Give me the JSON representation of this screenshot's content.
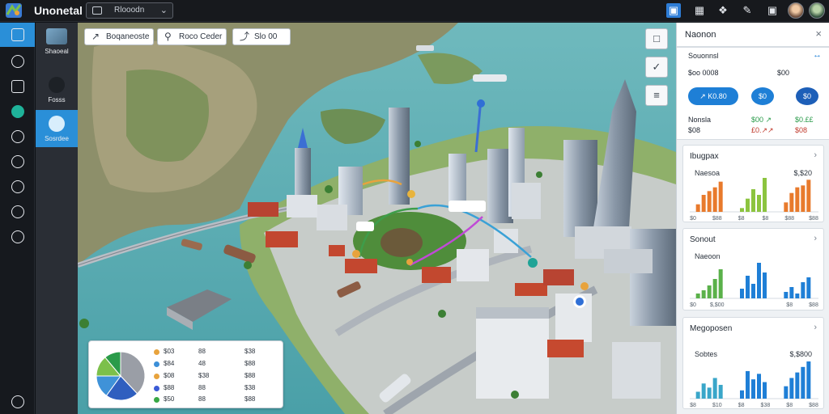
{
  "topbar": {
    "app_title": "Unonetal",
    "view_select": "Rlooodn",
    "icons": [
      "map-layer-icon",
      "grid-icon",
      "tag-icon",
      "pen-icon",
      "window-icon"
    ]
  },
  "rail": {
    "items": [
      "dashboard-icon",
      "globe-icon",
      "layers-icon",
      "location-icon",
      "route-icon",
      "analytics-icon",
      "graph-icon",
      "network-icon",
      "settings-icon"
    ]
  },
  "layers": {
    "items": [
      {
        "label": "Shaoeal"
      },
      {
        "label": "Fosss"
      },
      {
        "label": "Sosrdee"
      }
    ]
  },
  "map": {
    "chips": [
      {
        "icon": "↗",
        "label": "Boqaneoste"
      },
      {
        "icon": "⚲",
        "label": "Roco Ceder"
      },
      {
        "icon": "⤴",
        "label": "Slo 00"
      }
    ],
    "tools": [
      "□",
      "✓",
      "≡"
    ],
    "legend": {
      "rows": [
        {
          "color": "#e8a33d",
          "c1": "$03",
          "c2": "88",
          "c3": "$38"
        },
        {
          "color": "#3c8fd8",
          "c1": "$84",
          "c2": "48",
          "c3": "$88"
        },
        {
          "color": "#e8a33d",
          "c1": "$08",
          "c2": "$38",
          "c3": "$88"
        },
        {
          "color": "#3b5bd6",
          "c1": "$88",
          "c2": "88",
          "c3": "$38"
        },
        {
          "color": "#39a845",
          "c1": "$50",
          "c2": "88",
          "c3": "$88"
        }
      ],
      "pie": [
        {
          "value": 38,
          "color": "#9a9ea6"
        },
        {
          "value": 22,
          "color": "#2f5fbf"
        },
        {
          "value": 15,
          "color": "#3f92d8"
        },
        {
          "value": 14,
          "color": "#7cc04b"
        },
        {
          "value": 11,
          "color": "#2a9b4a"
        }
      ]
    }
  },
  "panel": {
    "title": "Naonon",
    "close": "×",
    "summary": {
      "label": "Souonnsl",
      "action": "↔",
      "row_label": "$oo 0008",
      "row_value": "$00",
      "pills": [
        "↗ K0.80",
        "$0",
        "$0"
      ],
      "stats": [
        {
          "label": "Nonsla",
          "value": "$00 ↗",
          "value_color": "#2a9b4a"
        },
        {
          "label": "$08",
          "value": "£0.↗↗",
          "value_color": "#c0392b"
        }
      ],
      "stat_values_extra": [
        "$0.££",
        "$08"
      ]
    },
    "cards": [
      {
        "title": "Ibugpax",
        "sub": "Naesoa",
        "value": "$,$20",
        "colors": [
          "#e87a2c",
          "#8cc43f",
          "#e87a2c"
        ],
        "groups": [
          [
            4,
            9,
            11,
            13,
            16
          ],
          [
            2,
            7,
            12,
            9,
            18
          ],
          [
            5,
            10,
            13,
            14,
            17
          ]
        ],
        "ticks": [
          "$0",
          "$88",
          "$8",
          "$8",
          "$88",
          "$88"
        ]
      },
      {
        "title": "Sonout",
        "sub": "Naeoon",
        "value": "",
        "colors": [
          "#5ab14a",
          "#1f7fd6",
          "#1f7fd6"
        ],
        "groups": [
          [
            3,
            5,
            8,
            12,
            18
          ],
          [
            6,
            14,
            9,
            22,
            16
          ],
          [
            4,
            7,
            3,
            10,
            13
          ]
        ],
        "ticks": [
          "$0",
          "$,$00",
          "",
          "",
          "$8",
          "$88"
        ]
      },
      {
        "title": "Megoposen",
        "sub": "Sobtes",
        "value": "$,$800",
        "colors": [
          "#3aa6c9",
          "#1f7fd6",
          "#1f7fd6"
        ],
        "groups": [
          [
            5,
            11,
            8,
            15,
            10
          ],
          [
            6,
            20,
            14,
            18,
            12
          ],
          [
            9,
            15,
            19,
            23,
            27
          ]
        ],
        "ticks": [
          "$8",
          "$10",
          "$8",
          "$38",
          "$8",
          "$88"
        ]
      }
    ]
  }
}
